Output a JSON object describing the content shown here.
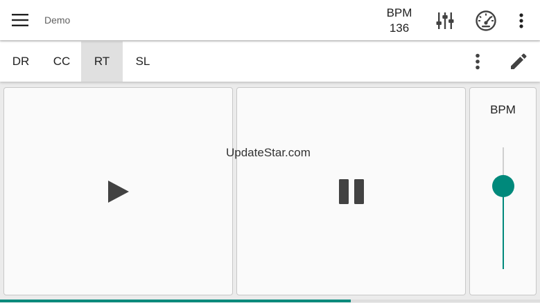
{
  "appbar": {
    "title": "Demo",
    "bpm_label": "BPM",
    "bpm_value": "136",
    "icons": [
      "menu-icon",
      "mixer-icon",
      "meter-icon",
      "more-vertical-icon"
    ]
  },
  "tabs": {
    "items": [
      {
        "label": "DR",
        "active": false
      },
      {
        "label": "CC",
        "active": false
      },
      {
        "label": "RT",
        "active": true
      },
      {
        "label": "SL",
        "active": false
      }
    ],
    "icons": [
      "more-vertical-icon",
      "pencil-icon"
    ]
  },
  "transport": {
    "play_icon": "play-icon",
    "pause_icon": "pause-icon"
  },
  "bpm_slider": {
    "label": "BPM",
    "level": 0.7
  },
  "watermark": "UpdateStar.com",
  "progress": {
    "fraction": 0.65
  },
  "colors": {
    "accent": "#00897b",
    "icon": "#424242",
    "active_tab": "#e0e0e0"
  }
}
